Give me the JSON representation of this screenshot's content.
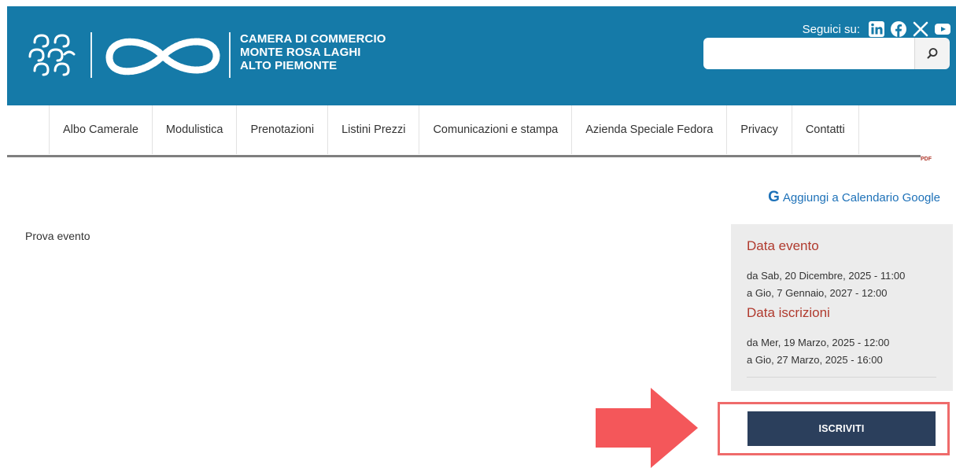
{
  "header": {
    "org_name_lines": [
      "CAMERA DI COMMERCIO",
      "MONTE ROSA LAGHI",
      "ALTO PIEMONTE"
    ],
    "social_label": "Seguici su:",
    "social_icons": [
      "linkedin-icon",
      "facebook-icon",
      "x-icon",
      "youtube-icon"
    ],
    "search": {
      "value": "",
      "placeholder": ""
    },
    "colors": {
      "band": "#157aa8",
      "text": "#ffffff"
    }
  },
  "nav": {
    "items": [
      "Albo Camerale",
      "Modulistica",
      "Prenotazioni",
      "Listini Prezzi",
      "Comunicazioni e stampa",
      "Azienda Speciale Fedora",
      "Privacy",
      "Contatti"
    ]
  },
  "pdf_label": "PDF",
  "google_calendar": {
    "icon_letter": "G",
    "label": "Aggiungi a Calendario Google"
  },
  "content": {
    "text": "Prova evento"
  },
  "event": {
    "data_evento_title": "Data evento",
    "data_evento_from": "da Sab, 20 Dicembre, 2025 - 11:00",
    "data_evento_to": "a Gio, 7 Gennaio, 2027 - 12:00",
    "data_iscrizioni_title": "Data iscrizioni",
    "data_iscrizioni_from": "da Mer, 19 Marzo, 2025 - 12:00",
    "data_iscrizioni_to": "a Gio, 27 Marzo, 2025 - 16:00",
    "title_color": "#b03a2e"
  },
  "cta": {
    "label": "ISCRIVITI",
    "color": "#2b3f5c",
    "highlight_color": "#ef6b6b"
  }
}
